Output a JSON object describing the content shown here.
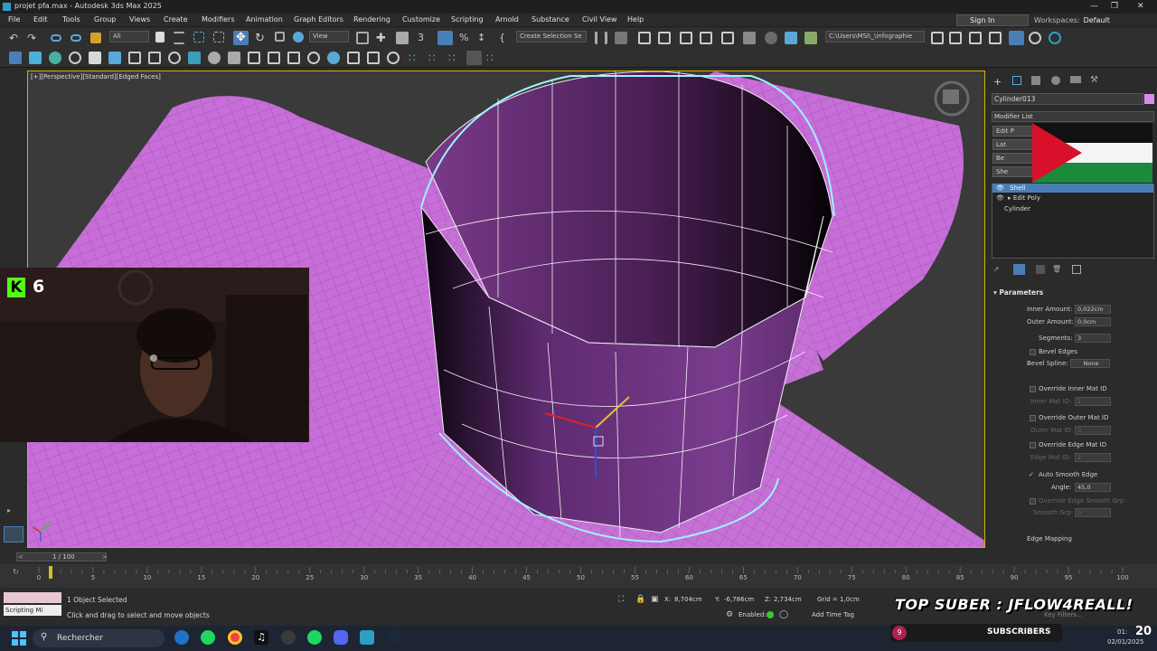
{
  "window": {
    "title": "projet pfa.max - Autodesk 3ds Max 2025"
  },
  "menu": [
    "File",
    "Edit",
    "Tools",
    "Group",
    "Views",
    "Create",
    "Modifiers",
    "Animation",
    "Graph Editors",
    "Rendering",
    "Customize",
    "Scripting",
    "Arnold",
    "Substance",
    "Civil View",
    "Help"
  ],
  "account": {
    "sign_in": "Sign In",
    "workspaces_label": "Workspaces:",
    "workspace": "Default"
  },
  "toolbar": {
    "filter": "All",
    "ref_coord": "View",
    "named_selection": "Create Selection Se",
    "path": "C:\\Users\\MSI\\_\\infographie"
  },
  "viewport": {
    "label": "[+][Perspective][Standard][Edged Faces]"
  },
  "stream": {
    "kick_count": "6",
    "top_suber": "TOP SUBER : JFLOW4REALL!",
    "subscribers_label": "SUBSCRIBERS",
    "subscribers_count": "20",
    "sub_small": "9"
  },
  "panel": {
    "object_name": "Cylinder013",
    "modifier_list": "Modifier List",
    "buttons": [
      "Edit P",
      "Lat",
      "Be",
      "She"
    ],
    "stack": [
      "Shell",
      "Edit Poly",
      "Cylinder"
    ],
    "section": "Parameters",
    "inner_amount_label": "Inner Amount:",
    "inner_amount": "0,022cm",
    "outer_amount_label": "Outer Amount:",
    "outer_amount": "0,0cm",
    "segments_label": "Segments:",
    "segments": "3",
    "bevel_edges": "Bevel Edges",
    "bevel_spline_label": "Bevel Spline:",
    "bevel_spline": "None",
    "override_inner": "Override Inner Mat ID",
    "inner_mat_label": "Inner Mat ID:",
    "inner_mat": "1",
    "override_outer": "Override Outer Mat ID",
    "outer_mat_label": "Outer Mat ID:",
    "outer_mat": "3",
    "override_edge": "Override Edge Mat ID",
    "edge_mat_label": "Edge Mat ID:",
    "edge_mat": "2",
    "auto_smooth": "Auto Smooth Edge",
    "angle_label": "Angle:",
    "angle": "45,0",
    "override_smooth": "Override Edge Smooth Grp",
    "smooth_grp_label": "Smooth Grp:",
    "smooth_grp": "0",
    "edge_mapping": "Edge Mapping"
  },
  "timeline": {
    "frame": "1 / 100",
    "ticks": [
      "0",
      "5",
      "10",
      "15",
      "20",
      "25",
      "30",
      "35",
      "40",
      "45",
      "50",
      "55",
      "60",
      "65",
      "70",
      "75",
      "80",
      "85",
      "90",
      "95",
      "100"
    ]
  },
  "status": {
    "selected": "1 Object Selected",
    "prompt": "Click and drag to select and move objects",
    "script": "Scripting Mi",
    "x_label": "X:",
    "x": "8,704cm",
    "y_label": "Y:",
    "y": "-6,786cm",
    "z_label": "Z:",
    "z": "2,734cm",
    "grid": "Grid = 1,0cm",
    "enabled": "Enabled:",
    "add_time_tag": "Add Time Tag",
    "key_filters": "Key Filters..."
  },
  "taskbar": {
    "search": "Rechercher",
    "time": "01:",
    "date": "02/01/2025"
  },
  "colors": {
    "accent": "#2c9fc4",
    "object": "#d98cf0",
    "kick": "#53fc18"
  }
}
